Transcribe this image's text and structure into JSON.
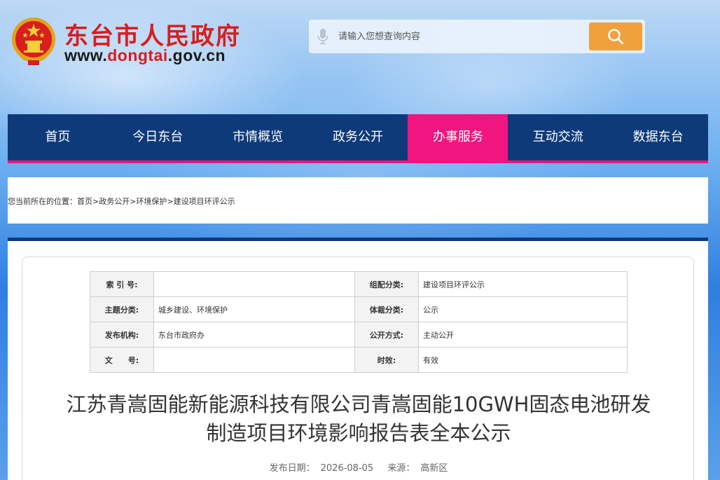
{
  "header": {
    "site_title": "东台市人民政府",
    "site_url_prefix": "www.",
    "site_url_accent": "dongtai",
    "site_url_suffix": ".gov.cn",
    "search_placeholder": "请输入您想查询内容"
  },
  "colors": {
    "brand_red": "#d81e1e",
    "nav_blue": "#0e3a7a",
    "nav_active": "#f0157f",
    "search_orange": "#f0a13c"
  },
  "nav": {
    "items": [
      {
        "label": "首页"
      },
      {
        "label": "今日东台"
      },
      {
        "label": "市情概览"
      },
      {
        "label": "政务公开"
      },
      {
        "label": "办事服务",
        "active": true
      },
      {
        "label": "互动交流"
      },
      {
        "label": "数据东台"
      }
    ]
  },
  "breadcrumb": {
    "prefix": "您当前所在的位置：",
    "items": [
      "首页",
      "政务公开",
      "环境保护",
      "建设项目环评公示"
    ],
    "separator": ">"
  },
  "meta": {
    "index_no_label": "索 引 号:",
    "index_no_value": "",
    "category_label": "组配分类:",
    "category_value": "建设项目环评公示",
    "topic_label": "主题分类:",
    "topic_value": "城乡建设、环境保护",
    "genre_label": "体裁分类:",
    "genre_value": "公示",
    "publisher_label": "发布机构:",
    "publisher_value": "东台市政府办",
    "open_mode_label": "公开方式:",
    "open_mode_value": "主动公开",
    "doc_no_label": "文　　号:",
    "doc_no_value": "",
    "validity_label": "时效:",
    "validity_value": "有效"
  },
  "article": {
    "title_line1": "江苏青嵩固能新能源科技有限公司青嵩固能10GWH固态电池研发",
    "title_line2": "制造项目环境影响报告表全本公示",
    "pub_date_label": "发布日期：",
    "pub_date": "2026-08-05",
    "source_label": "来源：",
    "source": "高新区"
  }
}
